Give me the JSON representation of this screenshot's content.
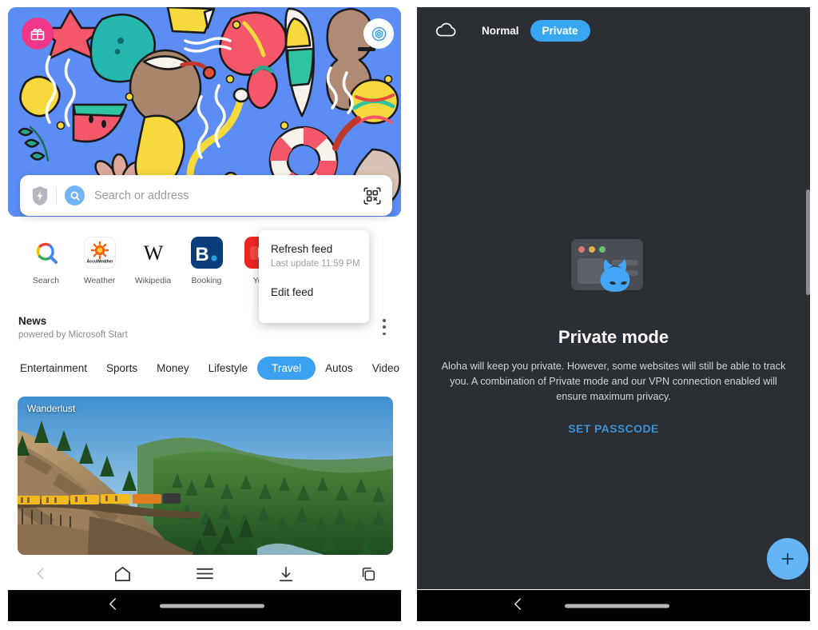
{
  "left_panel": {
    "wallpaper": {
      "name": "summer-doodles-wallpaper",
      "background_color": "#5b8df4"
    },
    "gift_badge": {
      "icon": "gift-icon",
      "color": "#f0378a"
    },
    "settings_badge": {
      "icon": "settings-hexagon-icon",
      "color": "#3ba0f0"
    },
    "search": {
      "placeholder": "Search or address",
      "shield_icon": "shield-bolt-icon",
      "search_icon": "search-icon",
      "qr_icon": "qr-scan-icon"
    },
    "shortcuts": [
      {
        "label": "Search",
        "icon": "google-search-icon",
        "glyph": ""
      },
      {
        "label": "Weather",
        "icon": "accuweather-icon",
        "glyph": "AccuWeather"
      },
      {
        "label": "Wikipedia",
        "icon": "wikipedia-icon",
        "glyph": "W"
      },
      {
        "label": "Booking",
        "icon": "booking-icon",
        "glyph": "B."
      },
      {
        "label": "You",
        "icon": "youtube-icon",
        "glyph": ""
      }
    ],
    "news": {
      "title": "News",
      "subtitle": "powered by Microsoft Start",
      "kebab_icon": "more-vertical-icon",
      "categories": [
        {
          "label": "Entertainment",
          "active": false
        },
        {
          "label": "Sports",
          "active": false
        },
        {
          "label": "Money",
          "active": false
        },
        {
          "label": "Lifestyle",
          "active": false
        },
        {
          "label": "Travel",
          "active": true
        },
        {
          "label": "Autos",
          "active": false
        },
        {
          "label": "Video",
          "active": false
        }
      ],
      "card": {
        "source_label": "Wanderlust"
      }
    },
    "menu_popup": {
      "refresh_label": "Refresh feed",
      "last_update": "Last update 11:59 PM",
      "edit_label": "Edit feed"
    },
    "toolbar": [
      {
        "name": "back-button",
        "icon": "chevron-left-icon",
        "disabled": true
      },
      {
        "name": "home-button",
        "icon": "home-icon",
        "disabled": false
      },
      {
        "name": "menu-button",
        "icon": "hamburger-icon",
        "disabled": false
      },
      {
        "name": "downloads-button",
        "icon": "download-icon",
        "disabled": false
      },
      {
        "name": "tabs-button",
        "icon": "tabs-icon",
        "disabled": false
      }
    ]
  },
  "right_panel": {
    "topbar": {
      "cloud_icon": "cloud-icon",
      "normal_label": "Normal",
      "private_label": "Private",
      "active_tab": "Private",
      "accent_color": "#39a6f2"
    },
    "illustration": {
      "icon": "private-mask-browser-icon",
      "mask_color": "#42a5f5"
    },
    "title": "Private mode",
    "description": "Aloha will keep you private. However, some websites will still be able to track you. A combination of Private mode and our VPN connection enabled will ensure maximum privacy.",
    "set_passcode_label": "SET PASSCODE",
    "fab": {
      "icon": "plus-icon",
      "color": "#64b5f6"
    }
  },
  "system_nav": {
    "back_icon": "chevron-left-icon",
    "home_pill": "home-pill"
  }
}
